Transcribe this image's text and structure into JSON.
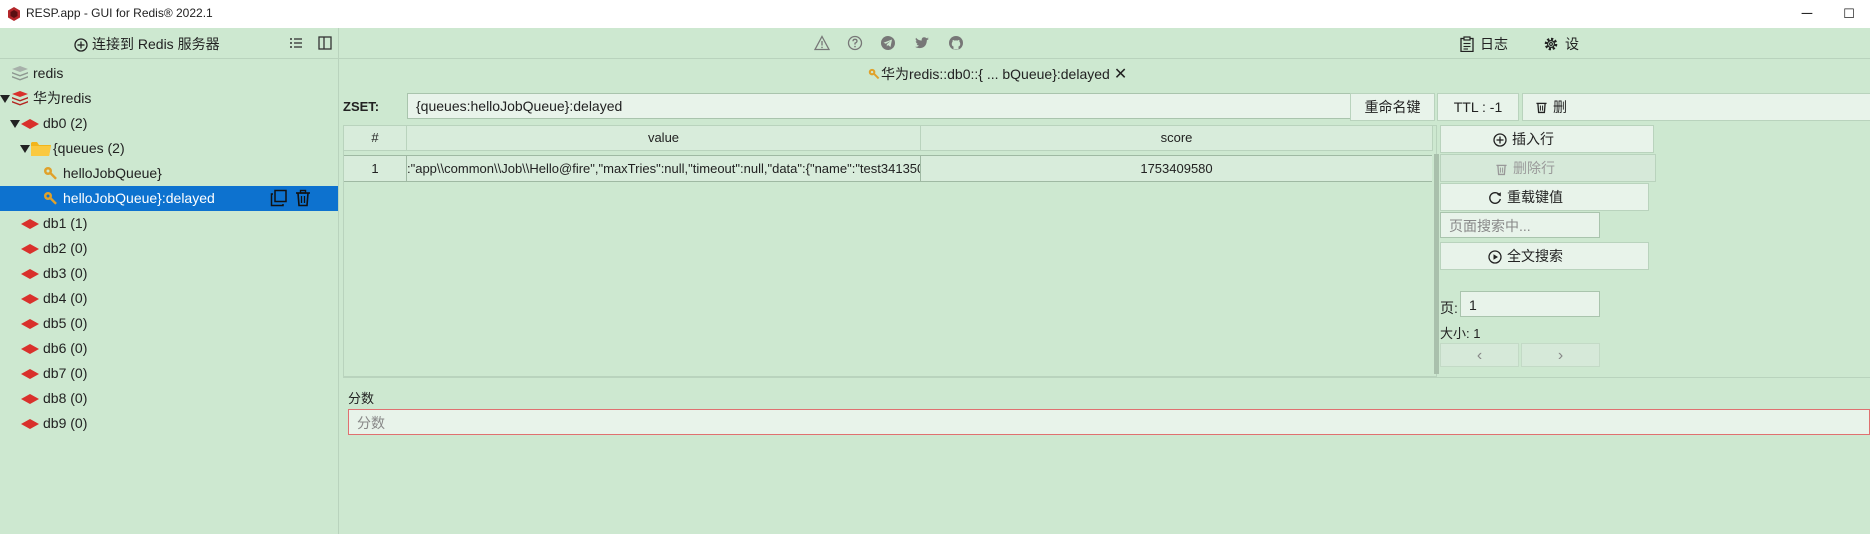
{
  "window": {
    "title": "RESP.app - GUI for Redis® 2022.1",
    "minimize": "─",
    "maximize": "☐",
    "icon": "resp-app-icon"
  },
  "left_toolbar": {
    "connect_label": "连接到 Redis 服务器"
  },
  "tree": {
    "items": [
      {
        "label": "redis",
        "icon": "redis-stack-gray-icon"
      },
      {
        "label": "华为redis",
        "icon": "redis-stack-red-icon"
      },
      {
        "label": "db0  (2)",
        "icon": "database-icon"
      },
      {
        "label": "{queues (2)",
        "icon": "folder-icon"
      },
      {
        "label": "helloJobQueue}",
        "icon": "key-icon"
      },
      {
        "label": "helloJobQueue}:delayed",
        "icon": "key-icon"
      },
      {
        "label": "db1  (1)",
        "icon": "database-icon"
      },
      {
        "label": "db2  (0)",
        "icon": "database-icon"
      },
      {
        "label": "db3  (0)",
        "icon": "database-icon"
      },
      {
        "label": "db4  (0)",
        "icon": "database-icon"
      },
      {
        "label": "db5  (0)",
        "icon": "database-icon"
      },
      {
        "label": "db6  (0)",
        "icon": "database-icon"
      },
      {
        "label": "db7  (0)",
        "icon": "database-icon"
      },
      {
        "label": "db8  (0)",
        "icon": "database-icon"
      },
      {
        "label": "db9  (0)",
        "icon": "database-icon"
      }
    ]
  },
  "main_toolbar": {
    "log_label": "日志",
    "settings_label": "设"
  },
  "tab": {
    "title": "华为redis::db0::{ ... bQueue}:delayed",
    "close": "✕"
  },
  "key": {
    "type_label": "ZSET:",
    "name": "{queues:helloJobQueue}:delayed",
    "rename_label": "重命名键",
    "ttl_label": "TTL : -1",
    "delete_label": "删"
  },
  "table": {
    "columns": [
      "#",
      "value",
      "score"
    ],
    "rows": [
      {
        "index": "1",
        "value": ":\"app\\\\common\\\\Job\\\\Hello@fire\",\"maxTries\":null,\"timeout\":null,\"data\":{\"name\":\"test341350:",
        "score": "1753409580"
      }
    ]
  },
  "side": {
    "insert_label": "插入行",
    "delete_row_label": "删除行",
    "reload_label": "重载键值",
    "search_placeholder": "页面搜索中...",
    "fulltext_label": "全文搜索",
    "page_label": "页:",
    "page_value": "1",
    "size_label": "大小: 1",
    "prev": "‹",
    "next": "›"
  },
  "editor": {
    "score_label": "分数",
    "score_placeholder": "分数"
  },
  "colors": {
    "background": "#cde8d0",
    "selection": "#0d72cf",
    "redis_red": "#d9302c",
    "folder": "#f2b51c"
  }
}
